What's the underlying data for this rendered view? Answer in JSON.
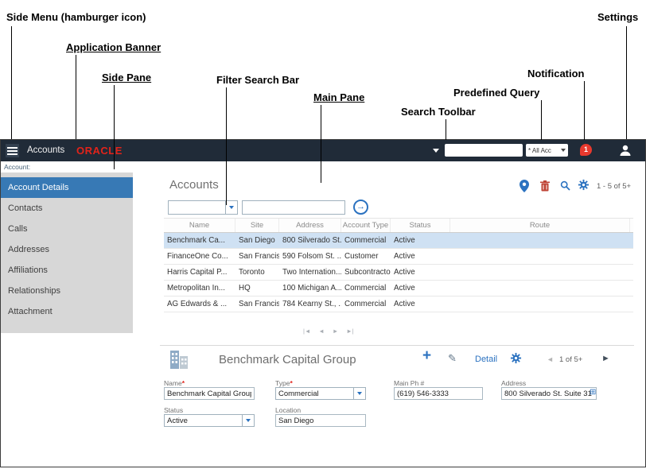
{
  "annotations": {
    "side_menu": "Side Menu (hamburger icon)",
    "application_banner": "Application Banner",
    "side_pane": "Side Pane",
    "filter_search_bar": "Filter Search Bar",
    "main_pane": "Main Pane",
    "search_toolbar": "Search Toolbar",
    "predefined_query": "Predefined Query",
    "notification": "Notification",
    "settings": "Settings"
  },
  "banner": {
    "app_title": "Accounts",
    "brand": "ORACLE",
    "pdq_value": "* All Acc",
    "notification_count": "1"
  },
  "breadcrumb": {
    "label": "Account:"
  },
  "sidebar": {
    "items": [
      {
        "label": "Account Details"
      },
      {
        "label": "Contacts"
      },
      {
        "label": "Calls"
      },
      {
        "label": "Addresses"
      },
      {
        "label": "Affiliations"
      },
      {
        "label": "Relationships"
      },
      {
        "label": "Attachment"
      }
    ]
  },
  "list_applet": {
    "title": "Accounts",
    "record_count": "1 - 5 of 5+",
    "columns": [
      "Name",
      "Site",
      "Address",
      "Account Type",
      "Status",
      "Route"
    ],
    "rows": [
      [
        "Benchmark Ca...",
        "San Diego",
        "800 Silverado St...",
        "Commercial",
        "Active",
        ""
      ],
      [
        "FinanceOne Co...",
        "San Francisco",
        "590 Folsom St. ...",
        "Customer",
        "Active",
        ""
      ],
      [
        "Harris Capital P...",
        "Toronto",
        "Two Internation...",
        "Subcontractor",
        "Active",
        ""
      ],
      [
        "Metropolitan In...",
        "HQ",
        "100 Michigan A...",
        "Commercial",
        "Active",
        ""
      ],
      [
        "AG Edwards & ...",
        "San Francisco",
        "784 Kearny St., ...",
        "Commercial",
        "Active",
        ""
      ]
    ]
  },
  "detail_applet": {
    "title": "Benchmark Capital Group",
    "detail_link_label": "Detail",
    "record_count": "1 of 5+",
    "required_marker": "*",
    "fields": {
      "name": {
        "label": "Name",
        "value": "Benchmark Capital Group"
      },
      "type": {
        "label": "Type",
        "value": "Commercial"
      },
      "main_ph": {
        "label": "Main Ph #",
        "value": "(619) 546-3333"
      },
      "address": {
        "label": "Address",
        "value": "800 Silverado St. Suite 31"
      },
      "status": {
        "label": "Status",
        "value": "Active"
      },
      "location": {
        "label": "Location",
        "value": "San Diego"
      }
    }
  },
  "icons": {
    "plus": "+",
    "pencil": "✎",
    "chevron_left": "◄",
    "chevron_right": "►",
    "go_arrow": "→",
    "page_first": "|◄",
    "page_prev": "◄",
    "page_next": "►",
    "page_last": "►|",
    "address_pick": "⊞"
  },
  "colors": {
    "banner_bg": "#202b38",
    "brand_red": "#e2231a",
    "accent_blue": "#2b72c0",
    "selected_item_bg": "#3779b5",
    "row_selected_bg": "#cfe1f3",
    "notification_red": "#e8392e"
  }
}
